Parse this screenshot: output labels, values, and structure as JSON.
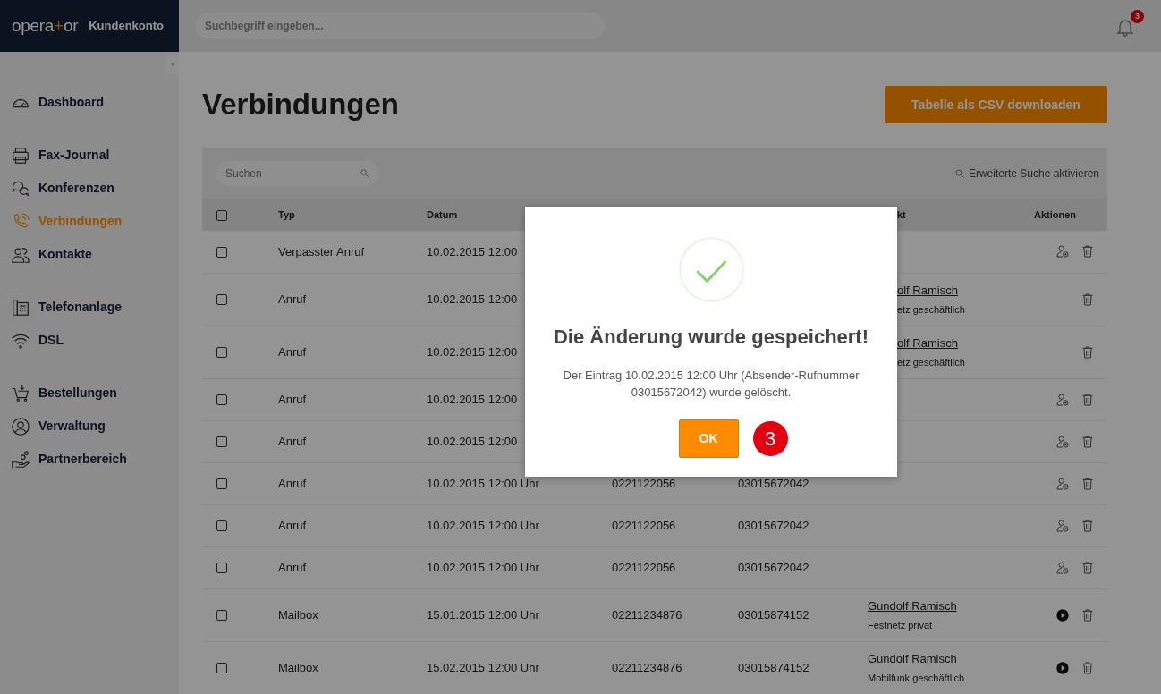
{
  "brand": {
    "logo": [
      "opera",
      "+",
      "or"
    ],
    "subtitle": "Kundenkonto"
  },
  "topbar": {
    "search": {
      "placeholder": "Suchbegriff eingeben..."
    },
    "notifications": "3"
  },
  "sidebar": {
    "groups": [
      [
        {
          "label": "Dashboard",
          "selected": false
        }
      ],
      [
        {
          "label": "Fax-Journal",
          "selected": false
        },
        {
          "label": "Konferenzen",
          "selected": false
        },
        {
          "label": "Verbindungen",
          "selected": true
        },
        {
          "label": "Kontakte",
          "selected": false
        }
      ],
      [
        {
          "label": "Telefonanlage",
          "selected": false
        },
        {
          "label": "DSL",
          "selected": false
        }
      ],
      [
        {
          "label": "Bestellungen",
          "selected": false
        },
        {
          "label": "Verwaltung",
          "selected": false
        },
        {
          "label": "Partnerbereich",
          "selected": false
        }
      ]
    ]
  },
  "page": {
    "title": "Verbindungen",
    "download_button": "Tabelle als CSV downloaden"
  },
  "table": {
    "search": {
      "placeholder": "Suchen"
    },
    "advanced_search": "Erweiterte Suche aktivieren",
    "header": {
      "checked": false,
      "columns": [
        "Typ",
        "Datum",
        "",
        "",
        "kt",
        "Aktionen"
      ]
    },
    "rows": [
      {
        "checked": false,
        "type": "Verpasster Anruf",
        "date": "10.02.2015 12:00",
        "actions": [
          {
            "kind": "contact"
          },
          {
            "kind": "delete"
          }
        ]
      },
      {
        "checked": false,
        "type": "Anruf",
        "date": "10.02.2015 12:00",
        "contact": {
          "name": "olf Ramisch",
          "detail": "etz geschäftlich",
          "clipped": true
        },
        "actions": [
          {
            "kind": "delete"
          }
        ]
      },
      {
        "checked": false,
        "type": "Anruf",
        "date": "10.02.2015 12:00",
        "contact": {
          "name": "olf Ramisch",
          "detail": "etz geschäftlich",
          "clipped": true
        },
        "actions": [
          {
            "kind": "delete"
          }
        ]
      },
      {
        "checked": false,
        "type": "Anruf",
        "date": "10.02.2015 12:00",
        "actions": [
          {
            "kind": "contact"
          },
          {
            "kind": "delete"
          }
        ]
      },
      {
        "checked": false,
        "type": "Anruf",
        "date": "10.02.2015 12:00",
        "actions": [
          {
            "kind": "contact"
          },
          {
            "kind": "delete"
          }
        ]
      },
      {
        "checked": false,
        "type": "Anruf",
        "date": "10.02.2015 12:00 Uhr",
        "from": "0221122056",
        "to": "03015672042",
        "actions": [
          {
            "kind": "contact"
          },
          {
            "kind": "delete"
          }
        ]
      },
      {
        "checked": false,
        "type": "Anruf",
        "date": "10.02.2015 12:00 Uhr",
        "from": "0221122056",
        "to": "03015672042",
        "actions": [
          {
            "kind": "contact"
          },
          {
            "kind": "delete"
          }
        ]
      },
      {
        "checked": false,
        "type": "Anruf",
        "date": "10.02.2015 12:00 Uhr",
        "from": "0221122056",
        "to": "03015672042",
        "actions": [
          {
            "kind": "contact"
          },
          {
            "kind": "delete"
          }
        ]
      },
      {
        "checked": false,
        "type": "Mailbox",
        "date": "15.01.2015 12:00 Uhr",
        "from": "02211234876",
        "to": "03015874152",
        "contact": {
          "name": "Gundolf Ramisch",
          "detail": "Festnetz privat"
        },
        "actions": [
          {
            "kind": "play"
          },
          {
            "kind": "delete"
          }
        ]
      },
      {
        "checked": false,
        "type": "Mailbox",
        "date": "15.02.2015 12:00 Uhr",
        "from": "02211234876",
        "to": "03015874152",
        "contact": {
          "name": "Gundolf Ramisch",
          "detail": "Mobilfunk geschäftlich"
        },
        "actions": [
          {
            "kind": "play"
          },
          {
            "kind": "delete"
          }
        ]
      }
    ]
  },
  "dialog": {
    "title": "Die Änderung wurde gespeichert!",
    "message": "Der Eintrag 10.02.2015 12:00 Uhr (Absender-Rufnummer 03015672042) wurde gelöscht.",
    "ok_button": "OK",
    "step_marker": "3"
  }
}
